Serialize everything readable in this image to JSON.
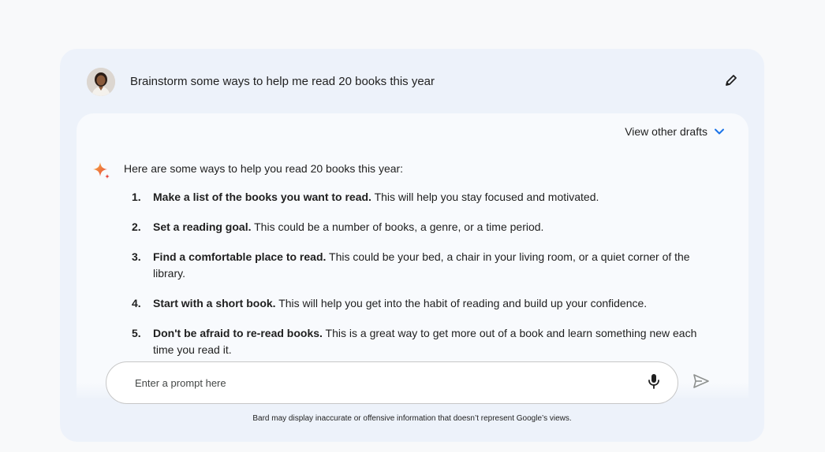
{
  "conversation": {
    "user_query": "Brainstorm some ways to help me read 20 books this year",
    "user_avatar_icon": "user-avatar",
    "edit_icon": "pencil-icon"
  },
  "response": {
    "drafts_label": "View other drafts",
    "drafts_icon": "chevron-down-icon",
    "model_icon": "sparkle-icon",
    "intro": "Here are some ways to help you read 20 books this year:",
    "steps": [
      {
        "num": "1.",
        "title": "Make a list of the books you want to read.",
        "body": " This will help you stay focused and motivated."
      },
      {
        "num": "2.",
        "title": "Set a reading goal.",
        "body": " This could be a number of books, a genre, or a time period."
      },
      {
        "num": "3.",
        "title": "Find a comfortable place to read.",
        "body": " This could be your bed, a chair in your living room, or a quiet corner of the library."
      },
      {
        "num": "4.",
        "title": "Start with a short book.",
        "body": " This will help you get into the habit of reading and build up your confidence."
      },
      {
        "num": "5.",
        "title": "Don't be afraid to re-read books.",
        "body": " This is a great way to get more out of a book and learn something new each time you read it."
      }
    ]
  },
  "input": {
    "placeholder": "Enter a prompt here",
    "mic_icon": "microphone-icon",
    "send_icon": "send-icon"
  },
  "footer": {
    "disclaimer": "Bard may display inaccurate or offensive information that doesn’t represent Google’s views."
  },
  "colors": {
    "page_background": "#f8f9fa",
    "panel_background": "#edf2fa",
    "card_background": "#f8fafd",
    "accent_blue": "#1a73e8",
    "sparkle_orange": "#f29b38",
    "sparkle_red": "#e8453c"
  }
}
